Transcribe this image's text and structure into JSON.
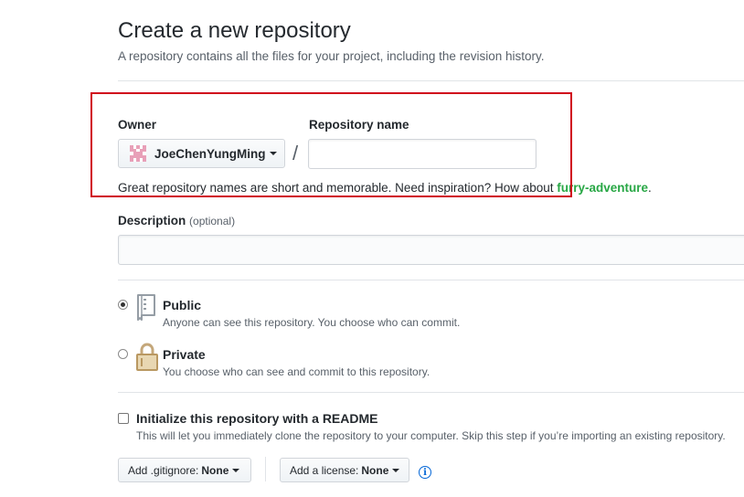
{
  "header": {
    "title": "Create a new repository",
    "subtitle": "A repository contains all the files for your project, including the revision history."
  },
  "owner": {
    "label": "Owner",
    "username": "JoeChenYungMing",
    "avatar_color": "#e8a0b8"
  },
  "repo_name": {
    "label": "Repository name",
    "value": "",
    "separator": "/"
  },
  "hint": {
    "text": "Great repository names are short and memorable. Need inspiration? How about ",
    "suggestion": "furry-adventure",
    "end": "."
  },
  "description": {
    "label": "Description",
    "optional": "(optional)",
    "value": ""
  },
  "visibility": {
    "public": {
      "title": "Public",
      "desc": "Anyone can see this repository. You choose who can commit.",
      "selected": true
    },
    "private": {
      "title": "Private",
      "desc": "You choose who can see and commit to this repository.",
      "selected": false
    }
  },
  "readme": {
    "title": "Initialize this repository with a README",
    "desc": "This will let you immediately clone the repository to your computer. Skip this step if you’re importing an existing repository.",
    "checked": false
  },
  "gitignore": {
    "prefix": "Add .gitignore:",
    "value": "None"
  },
  "license": {
    "prefix": "Add a license:",
    "value": "None"
  },
  "colors": {
    "highlight": "#d0021b",
    "suggestion": "#28a745",
    "info": "#0366d6"
  },
  "icons": {
    "info": "info-icon",
    "public": "repo-icon",
    "private": "lock-icon"
  }
}
